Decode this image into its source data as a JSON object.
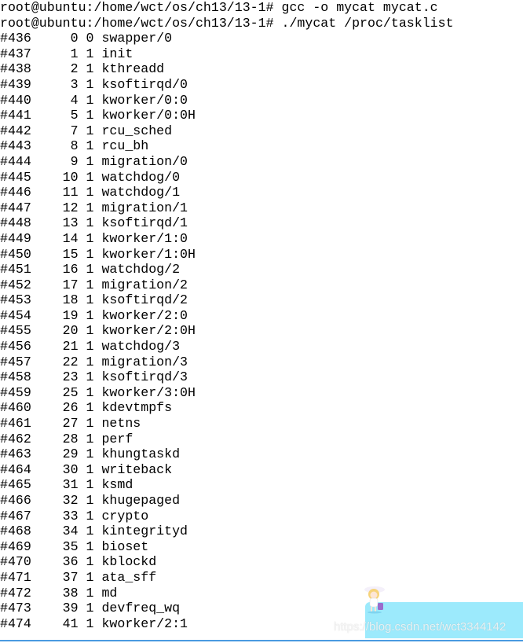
{
  "terminal": {
    "commands": [
      "root@ubuntu:/home/wct/os/ch13/13-1# gcc -o mycat mycat.c",
      "root@ubuntu:/home/wct/os/ch13/13-1# ./mycat /proc/tasklist"
    ],
    "tasks": [
      [
        "#436",
        0,
        0,
        "swapper/0"
      ],
      [
        "#437",
        1,
        1,
        "init"
      ],
      [
        "#438",
        2,
        1,
        "kthreadd"
      ],
      [
        "#439",
        3,
        1,
        "ksoftirqd/0"
      ],
      [
        "#440",
        4,
        1,
        "kworker/0:0"
      ],
      [
        "#441",
        5,
        1,
        "kworker/0:0H"
      ],
      [
        "#442",
        7,
        1,
        "rcu_sched"
      ],
      [
        "#443",
        8,
        1,
        "rcu_bh"
      ],
      [
        "#444",
        9,
        1,
        "migration/0"
      ],
      [
        "#445",
        10,
        1,
        "watchdog/0"
      ],
      [
        "#446",
        11,
        1,
        "watchdog/1"
      ],
      [
        "#447",
        12,
        1,
        "migration/1"
      ],
      [
        "#448",
        13,
        1,
        "ksoftirqd/1"
      ],
      [
        "#449",
        14,
        1,
        "kworker/1:0"
      ],
      [
        "#450",
        15,
        1,
        "kworker/1:0H"
      ],
      [
        "#451",
        16,
        1,
        "watchdog/2"
      ],
      [
        "#452",
        17,
        1,
        "migration/2"
      ],
      [
        "#453",
        18,
        1,
        "ksoftirqd/2"
      ],
      [
        "#454",
        19,
        1,
        "kworker/2:0"
      ],
      [
        "#455",
        20,
        1,
        "kworker/2:0H"
      ],
      [
        "#456",
        21,
        1,
        "watchdog/3"
      ],
      [
        "#457",
        22,
        1,
        "migration/3"
      ],
      [
        "#458",
        23,
        1,
        "ksoftirqd/3"
      ],
      [
        "#459",
        25,
        1,
        "kworker/3:0H"
      ],
      [
        "#460",
        26,
        1,
        "kdevtmpfs"
      ],
      [
        "#461",
        27,
        1,
        "netns"
      ],
      [
        "#462",
        28,
        1,
        "perf"
      ],
      [
        "#463",
        29,
        1,
        "khungtaskd"
      ],
      [
        "#464",
        30,
        1,
        "writeback"
      ],
      [
        "#465",
        31,
        1,
        "ksmd"
      ],
      [
        "#466",
        32,
        1,
        "khugepaged"
      ],
      [
        "#467",
        33,
        1,
        "crypto"
      ],
      [
        "#468",
        34,
        1,
        "kintegrityd"
      ],
      [
        "#469",
        35,
        1,
        "bioset"
      ],
      [
        "#470",
        36,
        1,
        "kblockd"
      ],
      [
        "#471",
        37,
        1,
        "ata_sff"
      ],
      [
        "#472",
        38,
        1,
        "md"
      ],
      [
        "#473",
        39,
        1,
        "devfreq_wq"
      ],
      [
        "#474",
        41,
        1,
        "kworker/2:1"
      ]
    ]
  },
  "watermark": {
    "text": "https://blog.csdn.net/wct3344142",
    "mascot_icon": "anime-girl-mascot"
  },
  "colors": {
    "watermark_bg": "#9ceafc",
    "bottom_line": "#4a9ae0"
  }
}
